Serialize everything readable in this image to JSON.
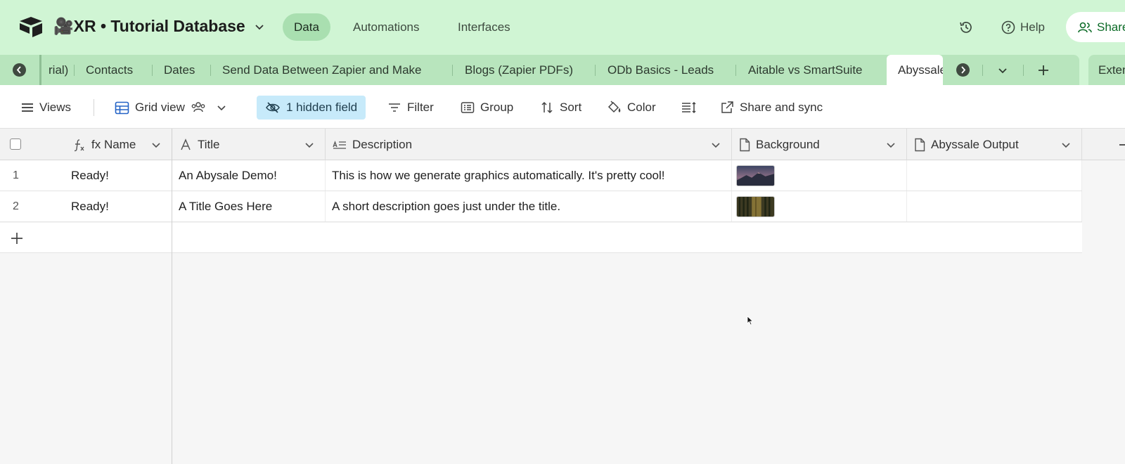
{
  "header": {
    "base_title": "🎥XR • Tutorial Database",
    "nav": [
      "Data",
      "Automations",
      "Interfaces"
    ],
    "help_label": "Help",
    "share_label": "Share"
  },
  "tabs": {
    "items": [
      "rial)",
      "Contacts",
      "Dates",
      "Send Data Between Zapier and Make",
      "Blogs (Zapier PDFs)",
      "ODb Basics - Leads",
      "Aitable vs SmartSuite"
    ],
    "active": "Abyssale",
    "external": "Extensions"
  },
  "toolbar": {
    "views": "Views",
    "grid_view": "Grid view",
    "hidden_field": "1 hidden field",
    "filter": "Filter",
    "group": "Group",
    "sort": "Sort",
    "color": "Color",
    "share_sync": "Share and sync"
  },
  "columns": [
    "fx Name",
    "Title",
    "Description",
    "Background",
    "Abyssale Output"
  ],
  "rows": [
    {
      "num": "1",
      "name": "Ready!",
      "title": "An Abysale Demo!",
      "description": "This is how we generate graphics automatically. It's pretty cool!",
      "background": "mountain-sunset-thumbnail"
    },
    {
      "num": "2",
      "name": "Ready!",
      "title": "A Title Goes Here",
      "description": "A short description goes just under the title.",
      "background": "forest-thumbnail"
    }
  ],
  "colors": {
    "header_bg": "#d0f5d4",
    "tabstrip_bg": "#b8e5bd",
    "active_nav": "#a9dfb0",
    "hidden_field_bg": "#c7eafa"
  }
}
